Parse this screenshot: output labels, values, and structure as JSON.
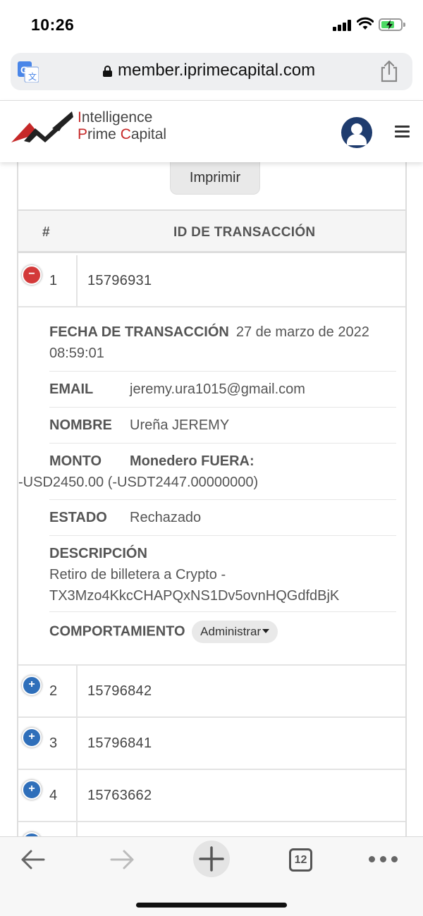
{
  "status_bar": {
    "time": "10:26"
  },
  "browser": {
    "url": "member.iprimecapital.com",
    "tabs_count": "12"
  },
  "site": {
    "logo_line1_cap": "I",
    "logo_line1_rest": "ntelligence",
    "logo_line2_a": "P",
    "logo_line2_b": "rime ",
    "logo_line2_c": "C",
    "logo_line2_d": "apital"
  },
  "toolbar": {
    "print_label": "Imprimir"
  },
  "table": {
    "col_num": "#",
    "col_id": "ID DE TRANSACCIÓN",
    "rows": [
      {
        "num": "1",
        "id": "15796931",
        "expanded": true
      },
      {
        "num": "2",
        "id": "15796842",
        "expanded": false
      },
      {
        "num": "3",
        "id": "15796841",
        "expanded": false
      },
      {
        "num": "4",
        "id": "15763662",
        "expanded": false
      }
    ]
  },
  "detail": {
    "date_label": "FECHA DE TRANSACCIÓN",
    "date_value": "27 de marzo de 2022 08:59:01",
    "email_label": "EMAIL",
    "email_value": "jeremy.ura1015@gmail.com",
    "name_label": "NOMBRE",
    "name_value": "Ureña JEREMY",
    "amount_label": "MONTO",
    "amount_wallet": "Monedero FUERA:",
    "amount_value": "-USD2450.00 (-USDT2447.00000000)",
    "status_label": "ESTADO",
    "status_value": "Rechazado",
    "desc_label": "DESCRIPCIÓN",
    "desc_value": "Retiro de billetera a Crypto - TX3Mzo4KkcCHAPQxNS1Dv5ovnHQGdfdBjK",
    "behavior_label": "COMPORTAMIENTO",
    "manage_label": "Administrar"
  },
  "colors": {
    "brand_red": "#c62828",
    "toggle_minus": "#d33a3a",
    "toggle_plus": "#2f6fba",
    "user_icon": "#1f3c6e"
  }
}
